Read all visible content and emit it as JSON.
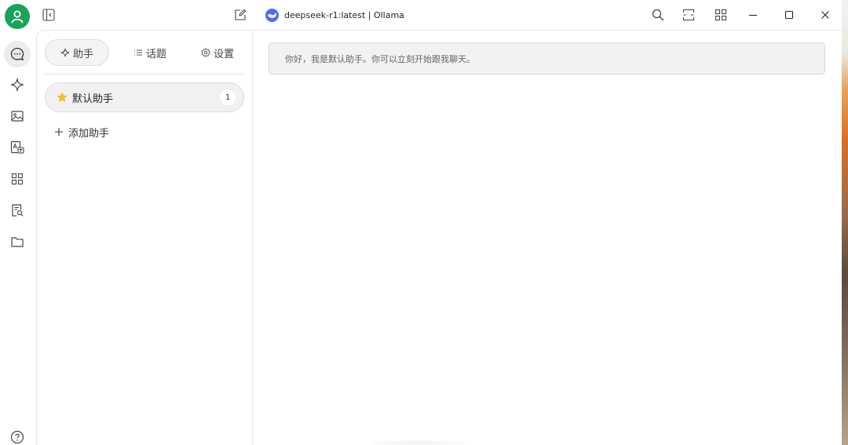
{
  "window": {
    "model_title": "deepseek-r1:latest | Ollama"
  },
  "tabs": [
    {
      "label": "助手",
      "icon": "sparkle-icon"
    },
    {
      "label": "话题",
      "icon": "list-icon"
    },
    {
      "label": "设置",
      "icon": "gear-icon"
    }
  ],
  "assistants": [
    {
      "name": "默认助手",
      "count": "1",
      "icon": "star-icon"
    }
  ],
  "add_assistant_label": "添加助手",
  "welcome_message": "你好，我是默认助手。你可以立刻开始跟我聊天。",
  "rail_icons": [
    "chat-icon",
    "sparkle-icon",
    "image-icon",
    "translate-icon",
    "apps-icon",
    "document-search-icon",
    "folder-icon",
    "help-icon"
  ],
  "colors": {
    "avatar": "#1aa25a",
    "model_logo": "#4d6bfe",
    "star": "#f5c518"
  }
}
